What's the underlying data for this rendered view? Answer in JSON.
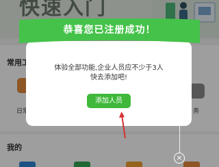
{
  "background": {
    "banner_text": "快速入门",
    "section_common_title": "常用工",
    "section_mine_title": "我的",
    "app_left_label": "日常",
    "app_right_label": "务"
  },
  "dialog": {
    "title": "恭喜您已注册成功！",
    "message_line1": "体验全部功能,企业人员应不少于3人",
    "message_line2": "快去添加吧!",
    "add_button_label": "添加人员",
    "close_symbol": "×"
  },
  "colors": {
    "accent_green": "#3fb83b",
    "ribbon_green": "#45c24a",
    "arrow_red": "#d83030"
  }
}
